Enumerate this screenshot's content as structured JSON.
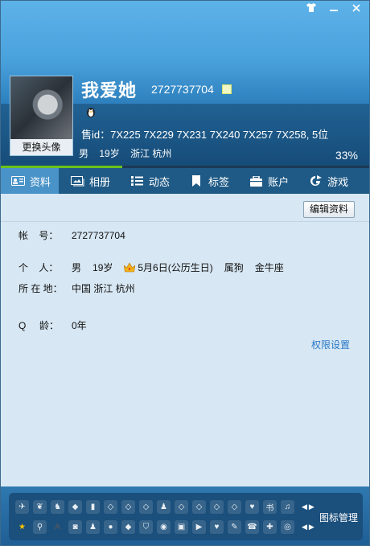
{
  "window": {
    "controls": [
      "skin",
      "minimize",
      "close"
    ]
  },
  "profile": {
    "nickname": "我爱她",
    "qq_number": "2727737704",
    "sale_id": "售id：7X225 7X229 7X231  7X240 7X257 7X258, 5位",
    "gender": "男",
    "age": "19岁",
    "location": "浙江 杭州",
    "completion_text": "33%",
    "completion_value": 33,
    "change_avatar_label": "更换头像"
  },
  "tabs": [
    {
      "label": "资料",
      "icon": "id-card-icon",
      "active": true
    },
    {
      "label": "相册",
      "icon": "photo-album-icon",
      "active": false
    },
    {
      "label": "动态",
      "icon": "list-icon",
      "active": false
    },
    {
      "label": "标签",
      "icon": "bookmark-icon",
      "active": false
    },
    {
      "label": "账户",
      "icon": "wallet-icon",
      "active": false
    },
    {
      "label": "游戏",
      "icon": "game-icon",
      "active": false
    }
  ],
  "details": {
    "edit_button": "编辑资料",
    "account_label": "帐    号：",
    "account_value": "2727737704",
    "personal_label": "个    人：",
    "personal_gender": "男",
    "personal_age": "19岁",
    "personal_birthday": "5月6日(公历生日)",
    "personal_zodiac": "属狗",
    "personal_constellation": "金牛座",
    "location_label": "所 在 地：",
    "location_value": "中国 浙江 杭州",
    "qage_label": "Q     龄：",
    "qage_value": "0年",
    "permission_link": "权限设置"
  },
  "icon_manager": {
    "label": "图标管理",
    "row1": [
      "bird-icon",
      "dove-icon",
      "penguin-cert-icon",
      "diamond-dark-icon",
      "mobile-icon",
      "diamond-icon",
      "diamond-icon",
      "diamond-icon",
      "penguin-icon",
      "diamond-icon",
      "diamond-icon",
      "diamond-icon",
      "diamond-icon",
      "heart-diamond-icon",
      "book-icon",
      "music-icon"
    ],
    "row2": [
      "star-icon",
      "search-icon",
      "app-icon",
      "camera-icon",
      "penguin-gray-icon",
      "chat-icon",
      "diamond-dark-icon",
      "shield-penguin-icon",
      "eye-icon",
      "gift-icon",
      "video-icon",
      "heart-shield-icon",
      "feather-icon",
      "phone-icon",
      "puzzle-icon",
      "disc-icon"
    ]
  }
}
